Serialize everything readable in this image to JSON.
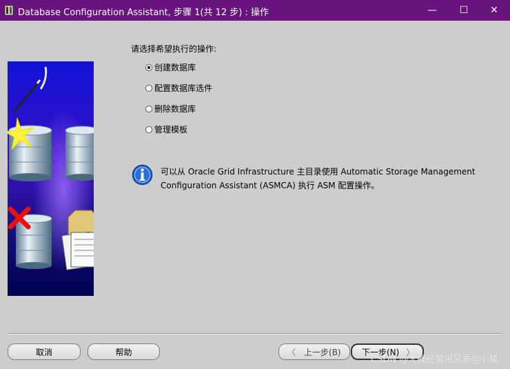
{
  "window": {
    "title": "Database Configuration Assistant, 步骤 1(共 12 步) : 操作",
    "minimize_glyph": "—",
    "maximize_glyph": "☐",
    "close_glyph": "✕"
  },
  "main": {
    "prompt": "请选择希望执行的操作:",
    "options": [
      {
        "label": "创建数据库",
        "selected": true
      },
      {
        "label": "配置数据库选件",
        "selected": false
      },
      {
        "label": "删除数据库",
        "selected": false
      },
      {
        "label": "管理模板",
        "selected": false
      }
    ],
    "info_text": "可以从 Oracle Grid Infrastructure 主目录使用 Automatic Storage Management Configuration Assistant (ASMCA) 执行 ASM 配置操作。"
  },
  "footer": {
    "cancel_label": "取消",
    "help_label": "帮助",
    "back_label": "上一步(B)",
    "next_label": "下一步(N)",
    "back_chevron": "〈",
    "next_chevron": "〉"
  },
  "watermark": "CSDN @大概经常闹风暴@小猿",
  "colors": {
    "titlebar": "#69137f",
    "banner_top": "#1010d0",
    "banner_bottom": "#000060",
    "info_icon": "#2a6fd6"
  }
}
